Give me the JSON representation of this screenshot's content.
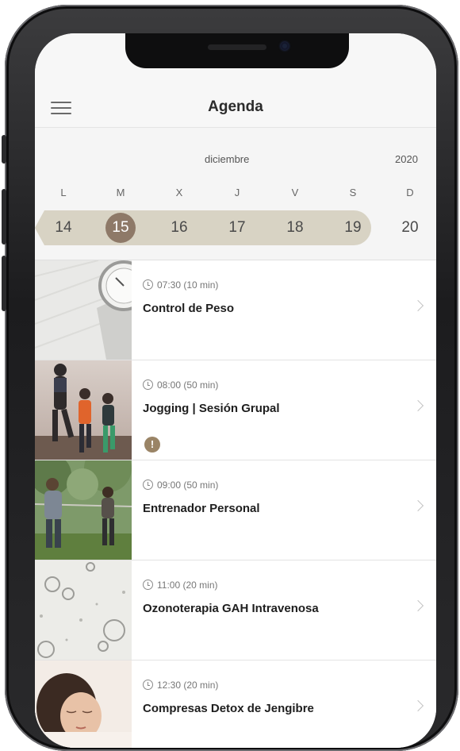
{
  "header": {
    "title": "Agenda",
    "menu_icon": "hamburger-menu-icon"
  },
  "calendar": {
    "month": "diciembre",
    "year": "2020",
    "weekdays": [
      "L",
      "M",
      "X",
      "J",
      "V",
      "S",
      "D"
    ],
    "days": [
      "14",
      "15",
      "16",
      "17",
      "18",
      "19",
      "20"
    ],
    "selected_day": "15",
    "colors": {
      "selected": "#8e7968",
      "week_band": "#d8d3c4"
    }
  },
  "agenda": {
    "items": [
      {
        "time": "07:30 (10 min)",
        "title": "Control de Peso",
        "alert": false,
        "thumb": "scale-image"
      },
      {
        "time": "08:00 (50 min)",
        "title": "Jogging | Sesión Grupal",
        "alert": true,
        "thumb": "joggers-image"
      },
      {
        "time": "09:00 (50 min)",
        "title": "Entrenador Personal",
        "alert": false,
        "thumb": "trainer-image"
      },
      {
        "time": "11:00 (20 min)",
        "title": "Ozonoterapia GAH Intravenosa",
        "alert": false,
        "thumb": "bubbles-image"
      },
      {
        "time": "12:30 (20 min)",
        "title": "Compresas Detox de Jengibre",
        "alert": false,
        "thumb": "massage-image"
      }
    ],
    "alert_glyph": "!"
  }
}
